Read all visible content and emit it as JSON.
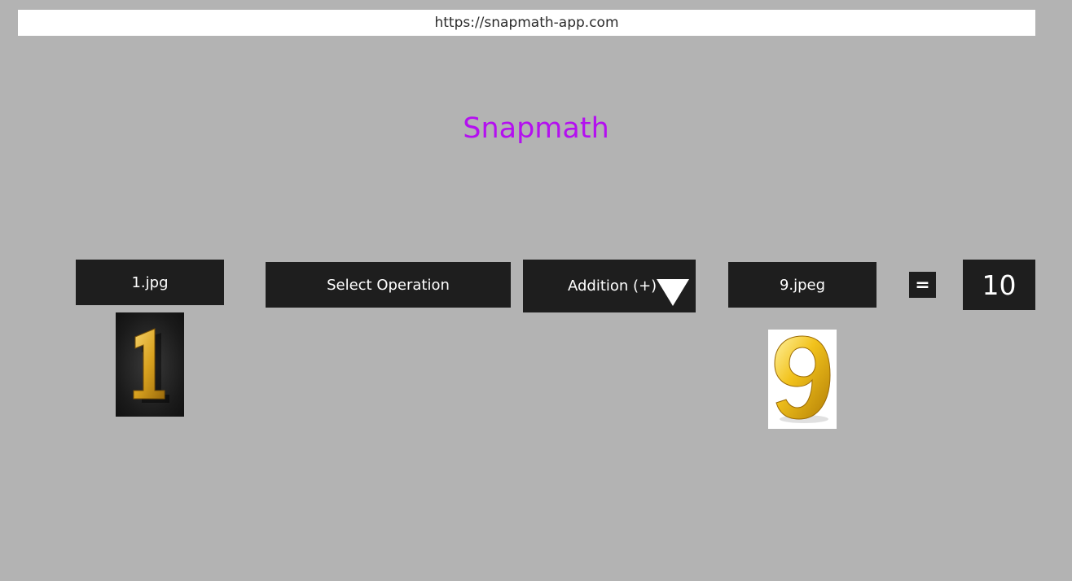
{
  "browser": {
    "url": "https://snapmath-app.com"
  },
  "app": {
    "title": "Snapmath",
    "title_color": "#b40ff0"
  },
  "calculator": {
    "first_file": {
      "label": "1.jpg",
      "image_digit": "1"
    },
    "select_operation_label": "Select Operation",
    "operation": {
      "selected": "Addition (+)",
      "icon": "dropdown-triangle-icon"
    },
    "second_file": {
      "label": "9.jpeg",
      "image_digit": "9"
    },
    "equals_label": "=",
    "result": "10"
  }
}
